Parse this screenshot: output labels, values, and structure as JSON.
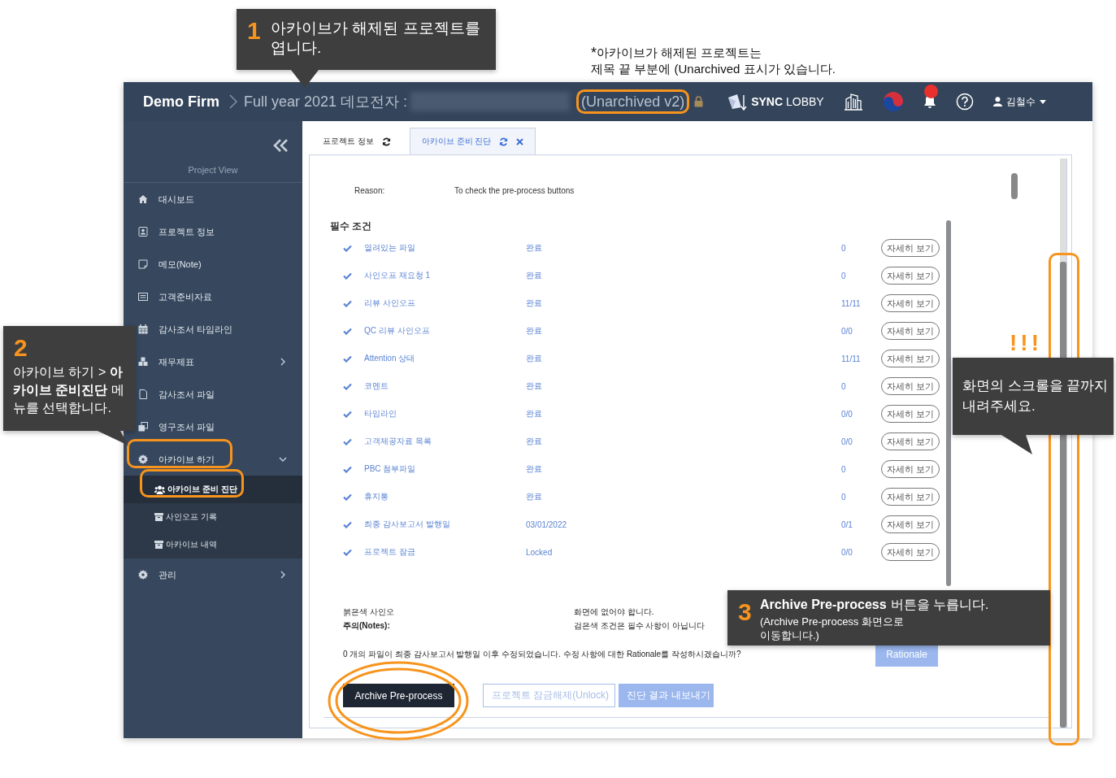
{
  "header": {
    "brand": "Demo Firm",
    "project_title": "Full year 2021 데모전자 :",
    "archive_status": "(Unarchived v2)",
    "locked": true,
    "sync_lobby": "**SYNC** LOBBY",
    "notification": true,
    "user": "김철수"
  },
  "sidebar": {
    "section_label": "Project View",
    "items": [
      {
        "label": "대시보드"
      },
      {
        "label": "프로젝트 정보"
      },
      {
        "label": "메모(Note)"
      },
      {
        "label": "고객준비자료"
      },
      {
        "label": "감사조서 타임라인"
      },
      {
        "label": "재무제표",
        "expanded": false
      },
      {
        "label": "감사조서 파일"
      },
      {
        "label": "영구조서 파일"
      },
      {
        "label": "아카이브 하기",
        "expanded": true,
        "children": [
          {
            "label": "아카이브 준비 진단",
            "selected": true
          },
          {
            "label": "사인오프 기록",
            "selected": false
          },
          {
            "label": "아카이브 내역",
            "selected": false
          }
        ]
      },
      {
        "label": "관리",
        "expanded": false
      }
    ]
  },
  "tabs": [
    {
      "label": "프로젝트 정보",
      "selected": false,
      "closable": false
    },
    {
      "label": "아카이브 준비 진단",
      "selected": true,
      "closable": true
    }
  ],
  "content": {
    "reason": {
      "label": "Reason:",
      "value": "To check the pre-process buttons"
    },
    "section_title": "필수 조건",
    "conditions": [
      {
        "name": "열려있는 파일",
        "status": "완료",
        "count": "0",
        "action": "자세히 보기",
        "checked": true
      },
      {
        "name": "사인오프 재요청 1",
        "status": "완료",
        "count": "0",
        "action": "자세히 보기",
        "checked": true
      },
      {
        "name": "리뷰 사인오프",
        "status": "완료",
        "count": "11/11",
        "action": "자세히 보기",
        "checked": true
      },
      {
        "name": "QC 리뷰 사인오프",
        "status": "완료",
        "count": "0/0",
        "action": "자세히 보기",
        "checked": true
      },
      {
        "name": "Attention 상태",
        "status": "완료",
        "count": "11/11",
        "action": "자세히 보기",
        "checked": true
      },
      {
        "name": "코멘트",
        "status": "완료",
        "count": "0",
        "action": "자세히 보기",
        "checked": true
      },
      {
        "name": "타임라인",
        "status": "완료",
        "count": "0/0",
        "action": "자세히 보기",
        "checked": true
      },
      {
        "name": "고객제공자료 목록",
        "status": "완료",
        "count": "0/0",
        "action": "자세히 보기",
        "checked": true
      },
      {
        "name": "PBC 첨부파일",
        "status": "완료",
        "count": "0",
        "action": "자세히 보기",
        "checked": true
      },
      {
        "name": "휴지통",
        "status": "완료",
        "count": "0",
        "action": "자세히 보기",
        "checked": true
      },
      {
        "name": "최종 감사보고서 발행일",
        "status": "03/01/2022",
        "count": "0/1",
        "action": "자세히 보기",
        "checked": true
      },
      {
        "name": "프로젝트 잠금",
        "status": "Locked",
        "count": "0/0",
        "action": "자세히 보기",
        "checked": true
      }
    ],
    "notes": [
      {
        "lead": "붉은색 사인오",
        "lead_bold": false,
        "tail": "화면에 없어야 합니다."
      },
      {
        "lead": "주의(Notes):",
        "lead_bold": true,
        "tail": "검은색 조건은 필수 사항이 아닙니다"
      }
    ],
    "rationale_question": "0 개의 파일이 최종 감사보고서 발행일 이후 수정되었습니다. 수정 사항에 대한 Rationale를 작성하시겠습니까?",
    "rationale_button": "Rationale",
    "actions": [
      {
        "label": "Archive Pre-process",
        "kind": "primary"
      },
      {
        "label": "프로젝트 잠금해제(Unlock)",
        "kind": "outline"
      },
      {
        "label": "진단 결과 내보내기",
        "kind": "light"
      }
    ]
  },
  "annotations": {
    "note": {
      "mark": "*",
      "text": "아카이브가 해제된 프로젝트는\n제목 끝 부분에 (Unarchived 표시가 있습니다."
    },
    "callouts": [
      {
        "kind": "step",
        "number": "1",
        "text": "아카이브가 해제된 프로젝트를\n엽니다."
      },
      {
        "kind": "step",
        "number": "2",
        "text": "아카이브 하기 >\n**아카이브 준비진단** 메뉴를\n선택합니다."
      },
      {
        "kind": "step",
        "number": "3",
        "title": "Archive Pre-process",
        "text": "버튼을 누릅니다.",
        "sub": "(Archive Pre-process 화면으로\n이동합니다.)"
      },
      {
        "kind": "alert",
        "number": "!!!",
        "text": "화면의 스크롤을 끝까지\n내려주세요."
      }
    ]
  }
}
